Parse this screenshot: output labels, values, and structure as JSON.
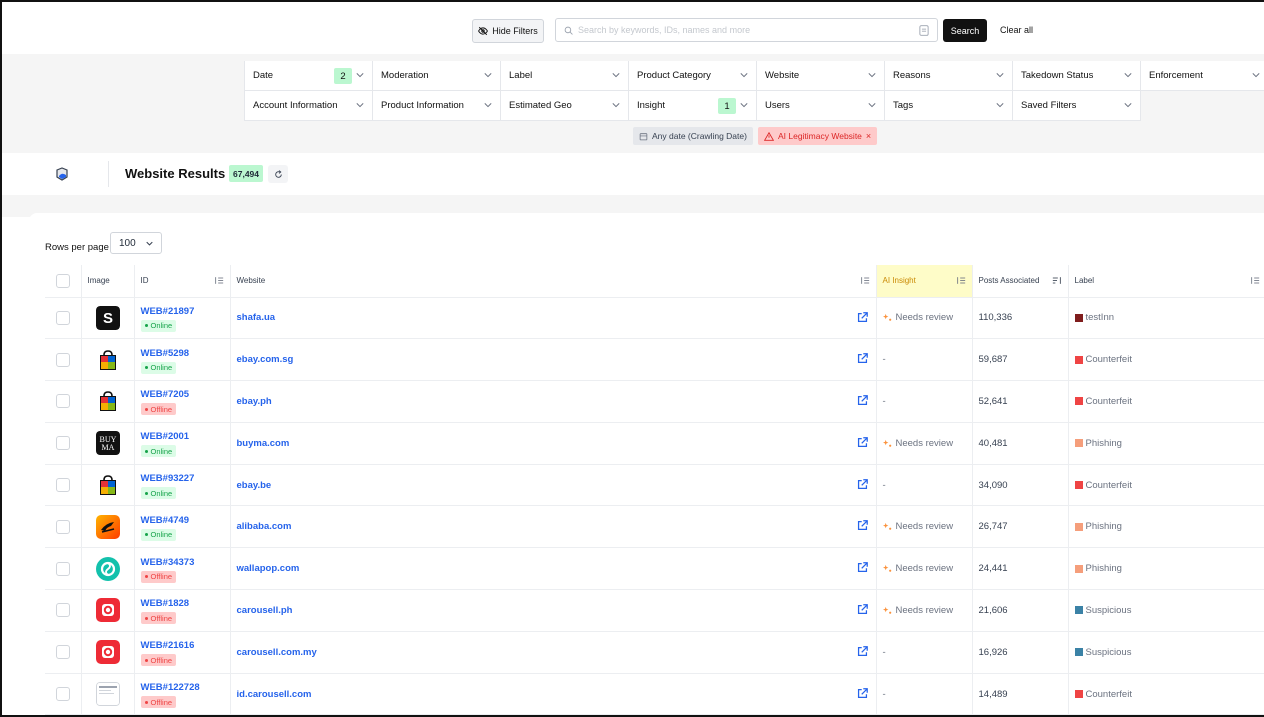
{
  "topbar": {
    "hide_filters_label": "Hide Filters",
    "search_placeholder": "Search by keywords, IDs, names and more",
    "search_button": "Search",
    "clear_all": "Clear all"
  },
  "filters": [
    {
      "label": "Date",
      "count": "2"
    },
    {
      "label": "Moderation",
      "count": ""
    },
    {
      "label": "Label",
      "count": ""
    },
    {
      "label": "Product Category",
      "count": ""
    },
    {
      "label": "Website",
      "count": ""
    },
    {
      "label": "Reasons",
      "count": ""
    },
    {
      "label": "Takedown Status",
      "count": ""
    },
    {
      "label": "Enforcement",
      "count": ""
    },
    {
      "label": "Account Information",
      "count": ""
    },
    {
      "label": "Product Information",
      "count": ""
    },
    {
      "label": "Estimated Geo",
      "count": ""
    },
    {
      "label": "Insight",
      "count": "1"
    },
    {
      "label": "Users",
      "count": ""
    },
    {
      "label": "Tags",
      "count": ""
    },
    {
      "label": "Saved Filters",
      "count": ""
    }
  ],
  "active_chips": {
    "date": "Any date (Crawling Date)",
    "legitimacy": "AI Legitimacy Website"
  },
  "results": {
    "title": "Website Results",
    "count": "67,494"
  },
  "pagination": {
    "rows_per_page_label": "Rows per page",
    "rows_per_page_value": "100"
  },
  "columns": {
    "image": "Image",
    "id": "ID",
    "website": "Website",
    "ai_insight": "AI Insight",
    "posts": "Posts Associated",
    "label": "Label"
  },
  "colors": {
    "accent": "#2563eb",
    "online": "#16a34a",
    "offline": "#ef4444",
    "testinn": "#7f1d1d",
    "counterfeit": "#ef4444",
    "phishing": "#f59e7b",
    "suspicious": "#3b82a6"
  },
  "rows": [
    {
      "id": "WEB#21897",
      "status": "Online",
      "website": "shafa.ua",
      "insight": "Needs review",
      "posts": "110,336",
      "label": "testInn",
      "label_color": "#7f1d1d",
      "image": "s-logo"
    },
    {
      "id": "WEB#5298",
      "status": "Online",
      "website": "ebay.com.sg",
      "insight": "-",
      "posts": "59,687",
      "label": "Counterfeit",
      "label_color": "#ef4444",
      "image": "ebay-bag"
    },
    {
      "id": "WEB#7205",
      "status": "Offline",
      "website": "ebay.ph",
      "insight": "-",
      "posts": "52,641",
      "label": "Counterfeit",
      "label_color": "#ef4444",
      "image": "ebay-bag"
    },
    {
      "id": "WEB#2001",
      "status": "Online",
      "website": "buyma.com",
      "insight": "Needs review",
      "posts": "40,481",
      "label": "Phishing",
      "label_color": "#f59e7b",
      "image": "buyma-logo"
    },
    {
      "id": "WEB#93227",
      "status": "Online",
      "website": "ebay.be",
      "insight": "-",
      "posts": "34,090",
      "label": "Counterfeit",
      "label_color": "#ef4444",
      "image": "ebay-bag"
    },
    {
      "id": "WEB#4749",
      "status": "Online",
      "website": "alibaba.com",
      "insight": "Needs review",
      "posts": "26,747",
      "label": "Phishing",
      "label_color": "#f59e7b",
      "image": "alibaba-logo"
    },
    {
      "id": "WEB#34373",
      "status": "Offline",
      "website": "wallapop.com",
      "insight": "Needs review",
      "posts": "24,441",
      "label": "Phishing",
      "label_color": "#f59e7b",
      "image": "wallapop-logo"
    },
    {
      "id": "WEB#1828",
      "status": "Offline",
      "website": "carousell.ph",
      "insight": "Needs review",
      "posts": "21,606",
      "label": "Suspicious",
      "label_color": "#3b82a6",
      "image": "carousell-logo"
    },
    {
      "id": "WEB#21616",
      "status": "Offline",
      "website": "carousell.com.my",
      "insight": "-",
      "posts": "16,926",
      "label": "Suspicious",
      "label_color": "#3b82a6",
      "image": "carousell-logo"
    },
    {
      "id": "WEB#122728",
      "status": "Offline",
      "website": "id.carousell.com",
      "insight": "-",
      "posts": "14,489",
      "label": "Counterfeit",
      "label_color": "#ef4444",
      "image": "page-thumb"
    }
  ]
}
